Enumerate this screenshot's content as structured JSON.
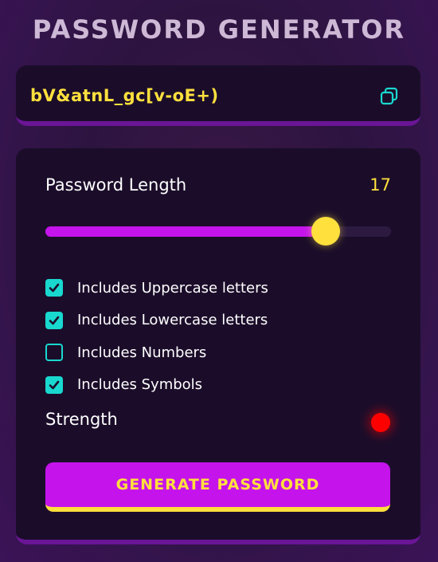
{
  "header": {
    "title": "PASSWORD GENERATOR"
  },
  "password_display": {
    "value": "bV&atnL_gc[v-oE+)",
    "copy_icon": "copy-icon"
  },
  "length": {
    "label": "Password Length",
    "value": "17",
    "slider_fraction": 0.81
  },
  "options": [
    {
      "label": "Includes Uppercase letters",
      "checked": true
    },
    {
      "label": "Includes Lowercase letters",
      "checked": true
    },
    {
      "label": "Includes Numbers",
      "checked": false
    },
    {
      "label": "Includes Symbols",
      "checked": true
    }
  ],
  "strength": {
    "label": "Strength",
    "indicator_color": "#ff0000"
  },
  "generate_button": {
    "label": "GENERATE PASSWORD"
  },
  "colors": {
    "accent": "#c414eb",
    "highlight": "#ffe03d",
    "checkbox": "#19d8cf",
    "panel": "#1b0d2a"
  }
}
